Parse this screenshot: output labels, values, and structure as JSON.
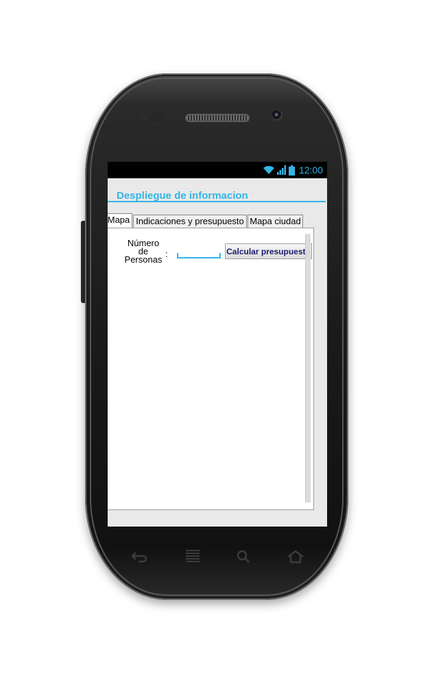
{
  "status_bar": {
    "time": "12:00",
    "icons": [
      "wifi-icon",
      "signal-icon",
      "battery-icon"
    ]
  },
  "app": {
    "title": "Despliegue de informacion",
    "tabs": [
      {
        "label": "Mapa",
        "active": true
      },
      {
        "label": "Indicaciones y presupuesto",
        "active": false
      },
      {
        "label": "Mapa ciudad",
        "active": false
      }
    ],
    "form": {
      "label_line1": "Número",
      "label_line2": "de",
      "label_line3": "Personas",
      "colon": ":",
      "input_value": "",
      "button_label": "Calcular presupuesto"
    }
  },
  "nav_icons": [
    "back-icon",
    "menu-icon",
    "search-icon",
    "home-icon"
  ],
  "colors": {
    "accent": "#33b5e5",
    "button_text": "#1a1a6e"
  }
}
